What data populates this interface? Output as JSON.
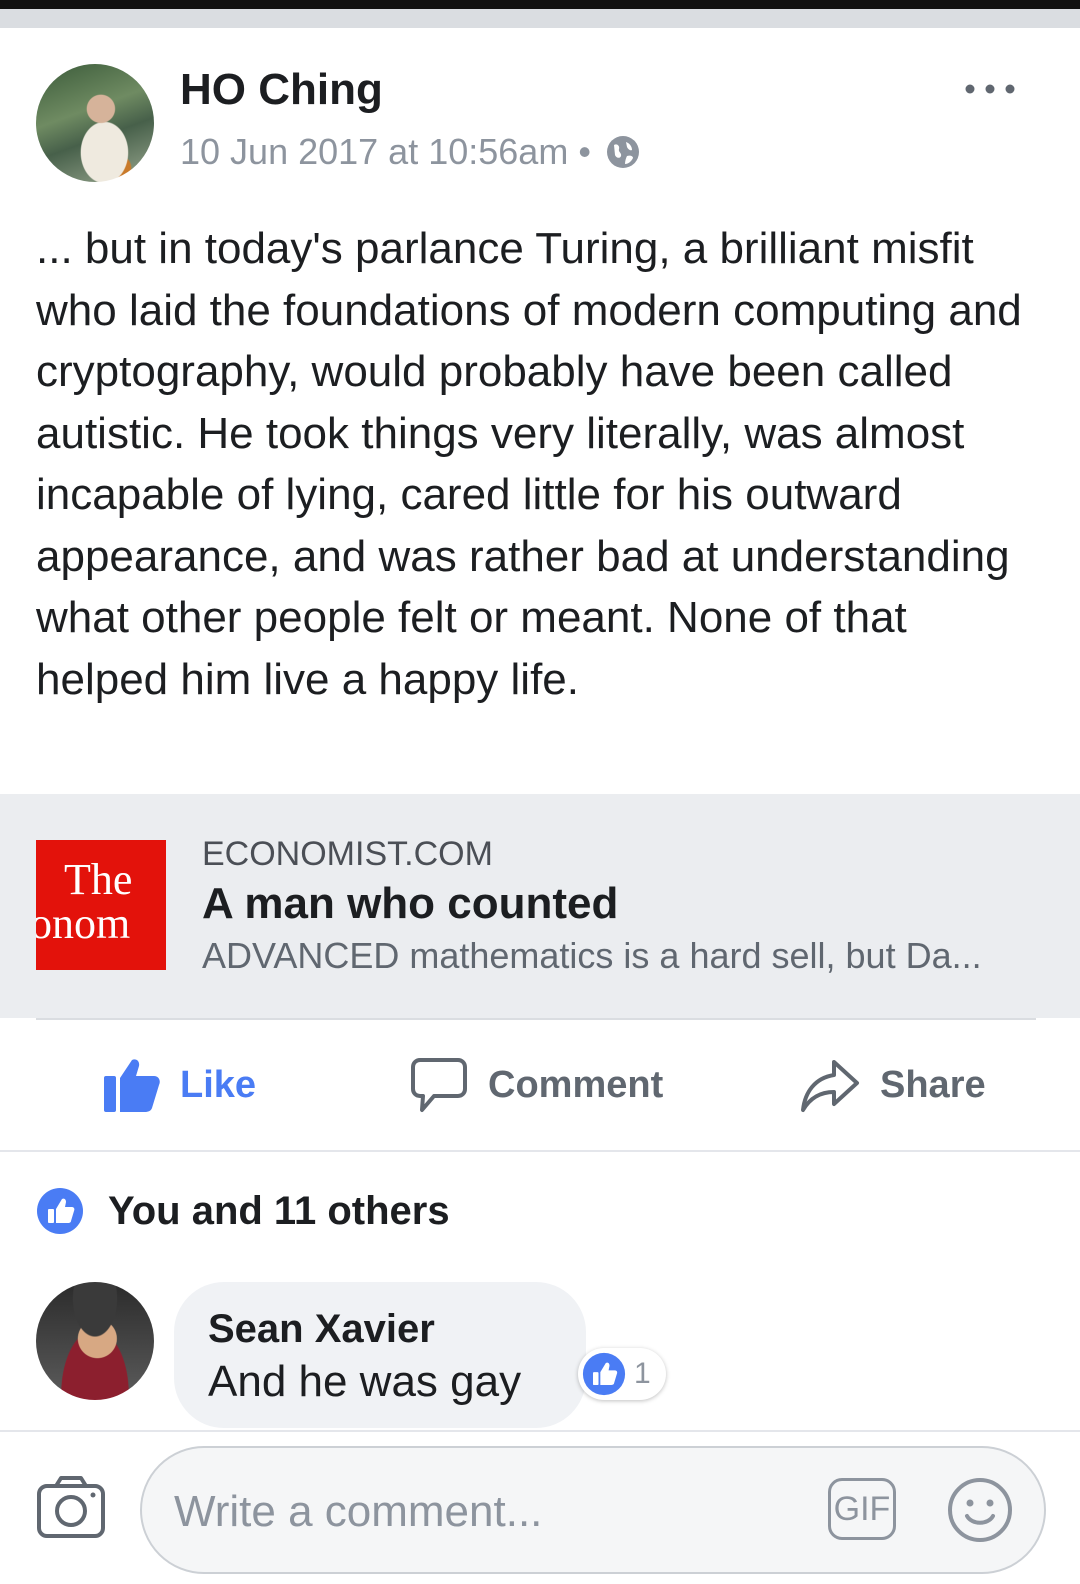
{
  "post": {
    "author": "HO Ching",
    "timestamp": "10 Jun 2017 at 10:56am",
    "meta_separator": "•",
    "privacy_icon": "globe-icon",
    "menu_icon": "more-options-icon",
    "text": "... but in today's parlance Turing, a brilliant misfit who laid the foundations of modern computing and cryptography, would probably have been called autistic. He took things very literally, was almost incapable of lying, cared little for his outward appearance, and was rather bad at understanding what other people felt or meant. None of that helped him live a happy life."
  },
  "link_preview": {
    "thumbnail_text_line1": "The",
    "thumbnail_text_line2": "onom",
    "domain": "ECONOMIST.COM",
    "title": "A man who counted",
    "description": "ADVANCED mathematics is a hard sell, but Da..."
  },
  "actions": {
    "like": "Like",
    "comment": "Comment",
    "share": "Share"
  },
  "reactions": {
    "summary": "You and 11 others",
    "icon": "like-reaction-icon"
  },
  "comments": [
    {
      "author": "Sean Xavier",
      "text": "And he was gay",
      "like_count": "1"
    }
  ],
  "composer": {
    "placeholder": "Write a comment...",
    "gif_label": "GIF",
    "camera_icon": "camera-icon",
    "emoji_icon": "emoji-icon"
  },
  "colors": {
    "like_blue": "#4a7cf4",
    "economist_red": "#e3120b",
    "secondary_text": "#8d949e"
  }
}
